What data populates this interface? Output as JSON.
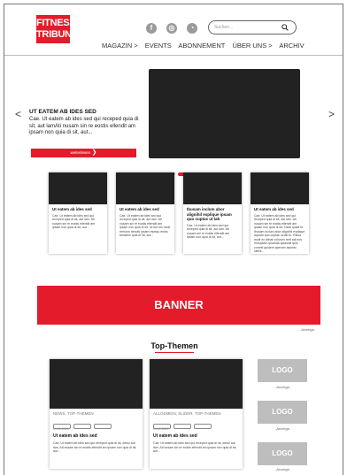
{
  "brand": {
    "line1": "FITNESS",
    "line2": "TRIBUNE"
  },
  "colors": {
    "accent": "#e31b2a",
    "dark": "#222222",
    "ad_gray": "#bdbdbd"
  },
  "social": [
    {
      "icon": "facebook-icon",
      "glyph": "f"
    },
    {
      "icon": "instagram-icon",
      "glyph": "◎"
    },
    {
      "icon": "rss-icon",
      "glyph": "◔"
    }
  ],
  "search": {
    "placeholder": "Suchen...",
    "icon": "search-icon"
  },
  "nav": [
    "MAGAZIN >",
    "EVENTS",
    "ABONNEMENT",
    "ÜBER UNS >",
    "ARCHIV"
  ],
  "hero": {
    "title": "UT EATEM AB IDES SED",
    "text": "Cae. Ut eatem ab ides sed qui receped quia di sit, aut lamAti nusam sin re eostis ellendit am ipsam non quia di sit, aut...",
    "button": "weiterlesen",
    "arrow_left": "<",
    "arrow_right": ">",
    "slide_count": 4,
    "active_slide": 4
  },
  "cards": [
    {
      "title": "Ut eatem ab ides sed",
      "text": "Cae. Ut eatem ab ides sed qui receped quia di sit, aut lam. Ati nusam sin re eostis ellendit am ipsam non quia di sit, aut..."
    },
    {
      "title": "Ut eatem ab ides sed",
      "text": "Cae. Ut eatem ab ides sed qui receped quia di sit, aut lam. Ati nusam sin re eostis ellendit am ipsam non quia di sit, Ut fuit olo nobit rerrions dendis ipsam repequ endis beratem quia di sit, aut..."
    },
    {
      "title": "Ibusam inclum abor alignihil explique ipsam quo cuptas ut lab",
      "text": "Cae. Ut eatem ab ides sed qui receped quia di sit, aut lam. Ati nusam sin re eostis ellendit am ipsam non quia di sit, aut..."
    },
    {
      "title": "Ut eatem ab ides sed",
      "text": "Cae. Ut eatem ab ides sed qui receped quia di sit, aut lam. Ati nusam sin re eostis ellendit am ipsam non quia di sit. Ossit quide bi. Ibusam inclum abor alignihil explique aquam quo cuptas ut lab to. Ribus molit ex alinat volorum rerit adi eos moluptam ipsanda quiassiti quis comnit quidem aperum assinto sitent..."
    }
  ],
  "banner": {
    "label": "BANNER",
    "ad_label": "Anzeige"
  },
  "top_themen": {
    "title": "Top-Themen",
    "cards": [
      {
        "category": "NEWS, TOP-THEMEN",
        "pill_count": 3,
        "date": "01.12.2020",
        "title": "Ut eatem ab ides sed",
        "text": "Cae. Ut eatem ab ides sed qui receped quia di sit, desui aut lam. Ati nusam sin re eostis ellendit am ipsam non quia di sit, aut..."
      },
      {
        "category": "ALLGEMEIN, SLIDER, TOP-THEMEN",
        "pill_count": 3,
        "date": "01.12.2020",
        "title": "Ut eatem ab ides sed",
        "text": "Cae. Ut eatem ab ides sed qui receped quia di sit, desui aut lam. Ati nusam sin re eostis ellendit am ipsam non quia di sit, aut..."
      }
    ]
  },
  "ad_logos": [
    {
      "label": "LOGO",
      "ad_label": "Anzeige"
    },
    {
      "label": "LOGO",
      "ad_label": "Anzeige"
    },
    {
      "label": "LOGO",
      "ad_label": "Anzeige"
    }
  ]
}
